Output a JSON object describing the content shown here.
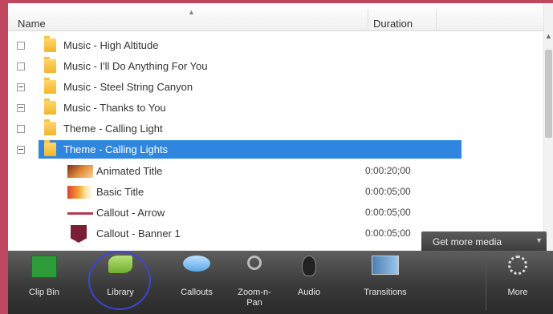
{
  "header": {
    "name_col": "Name",
    "duration_col": "Duration"
  },
  "rows": [
    {
      "label": "Music - High Altitude",
      "expander": "plus"
    },
    {
      "label": "Music - I'll Do Anything For You",
      "expander": "plus"
    },
    {
      "label": "Music - Steel String Canyon",
      "expander": "minus"
    },
    {
      "label": "Music - Thanks to You",
      "expander": "minus"
    },
    {
      "label": "Theme - Calling Light",
      "expander": "plus"
    },
    {
      "label": "Theme - Calling Lights",
      "expander": "minus",
      "selected": true
    }
  ],
  "children": [
    {
      "label": "Animated Title",
      "duration": "0:00:20;00",
      "thumb": "title"
    },
    {
      "label": "Basic Title",
      "duration": "0:00:05;00",
      "thumb": "basic"
    },
    {
      "label": "Callout - Arrow",
      "duration": "0:00:05;00",
      "thumb": "arrow"
    },
    {
      "label": "Callout - Banner 1",
      "duration": "0:00:05;00",
      "thumb": "banner"
    }
  ],
  "get_more": {
    "label": "Get more media"
  },
  "toolbar": {
    "clip_bin": "Clip Bin",
    "library": "Library",
    "callouts": "Callouts",
    "zoom_pan_line1": "Zoom-n-",
    "zoom_pan_line2": "Pan",
    "audio": "Audio",
    "transitions": "Transitions",
    "more": "More"
  },
  "colors": {
    "selection": "#2f86de",
    "frame": "#c0485e",
    "library_ring": "#3a46d8"
  },
  "icons": [
    "folder-icon",
    "clip-bin-icon",
    "library-icon",
    "callouts-icon",
    "zoom-pan-icon",
    "audio-icon",
    "transitions-icon",
    "more-icon"
  ]
}
